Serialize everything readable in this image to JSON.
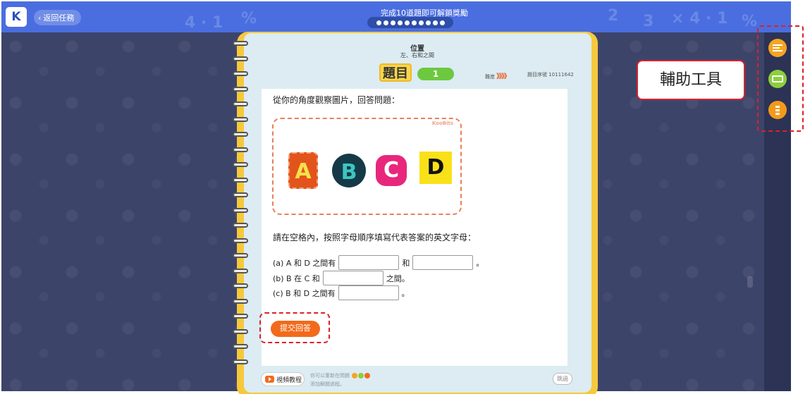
{
  "topbar": {
    "logo": "K",
    "back_label": "返回任務",
    "progress_text": "完成10道題即可解鎖獎勵",
    "progress_dot_count": 10
  },
  "question": {
    "title": "位置",
    "subtitle": "左、右和之間",
    "label": "題目",
    "number": "1",
    "difficulty_label": "難度",
    "difficulty_marks": "》》》》",
    "id_label": "題目序號 10111642",
    "prompt": "從你的角度觀察圖片，回答問題：",
    "image_brand": "KooBits",
    "letters": [
      "A",
      "B",
      "C",
      "D"
    ],
    "instruction": "請在空格內，按照字母順序填寫代表答案的英文字母：",
    "part_a_prefix": "(a) A 和 D 之間有",
    "part_a_mid": "和",
    "part_a_end": "。",
    "part_b_prefix": "(b) B 在 C 和",
    "part_b_end": "之間。",
    "part_c_prefix": "(c) B 和 D 之間有",
    "part_c_end": "。",
    "submit_label": "提交回答"
  },
  "footer": {
    "video_label": "視頻教程",
    "note_line1": "你可以重新在問題",
    "note_line2": "添加解題過程。",
    "skip_label": "跳過"
  },
  "tools": {
    "callout_label": "輔助工具",
    "items": [
      "ruler-tool",
      "calculator-tool",
      "abacus-tool"
    ]
  },
  "colors": {
    "topbar": "#4a6ee0",
    "background": "#3d4469",
    "notebook": "#f6c93c",
    "accent": "#f26a1b",
    "highlight": "#d9222a"
  }
}
